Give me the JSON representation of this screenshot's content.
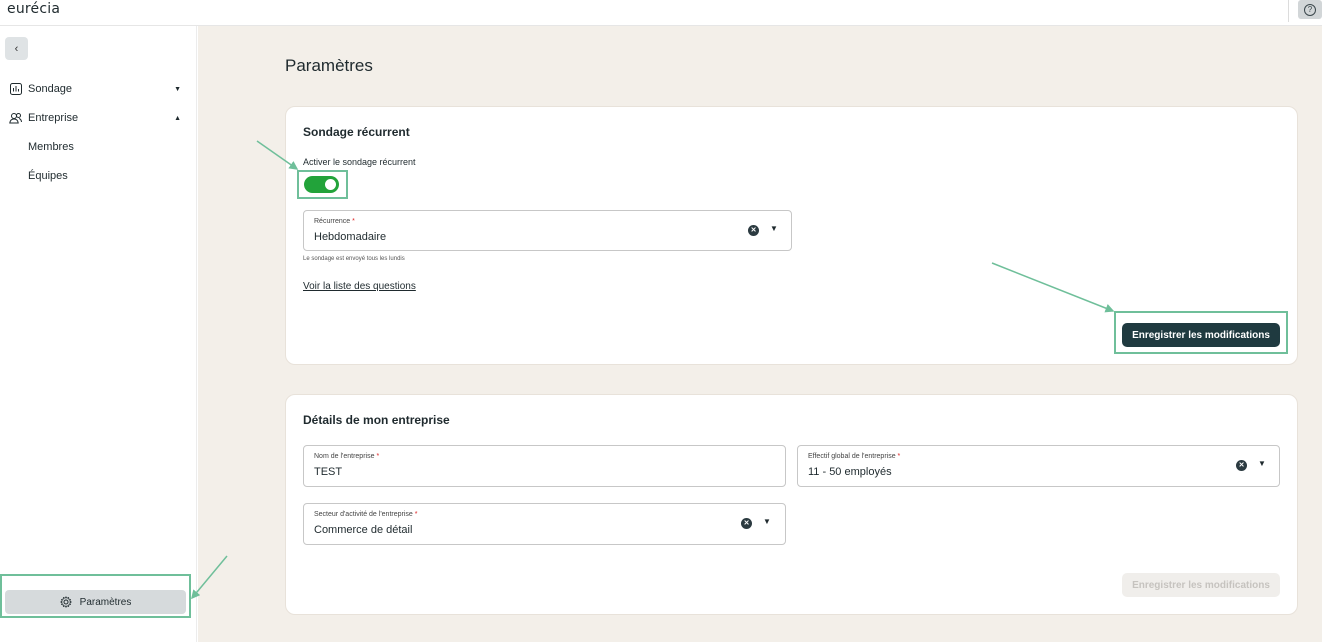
{
  "app": {
    "logo": "eurécia"
  },
  "sidebar": {
    "items": [
      {
        "label": "Sondage",
        "icon": "bar-chart-icon",
        "expanded": false
      },
      {
        "label": "Entreprise",
        "icon": "users-icon",
        "expanded": true,
        "children": [
          "Membres",
          "Équipes"
        ]
      }
    ],
    "settings_label": "Paramètres"
  },
  "main": {
    "title": "Paramètres",
    "recurring": {
      "title": "Sondage récurrent",
      "toggle_label": "Activer le sondage récurrent",
      "toggle_on": true,
      "recurrence_label": "Récurrence",
      "recurrence_value": "Hebdomadaire",
      "helper": "Le sondage est envoyé tous les lundis",
      "link": "Voir la liste des questions",
      "save_label": "Enregistrer les modifications"
    },
    "company": {
      "title": "Détails de mon entreprise",
      "name_label": "Nom de l'entreprise",
      "name_value": "TEST",
      "size_label": "Effectif global de l'entreprise",
      "size_value": "11 - 50 employés",
      "sector_label": "Secteur d'activité de l'entreprise",
      "sector_value": "Commerce de détail",
      "save_label": "Enregistrer les modifications"
    }
  },
  "colors": {
    "accent_dark": "#1f3a40",
    "toggle_green": "#22a33a",
    "highlight": "#6fbf9a",
    "background": "#f3efe9"
  }
}
